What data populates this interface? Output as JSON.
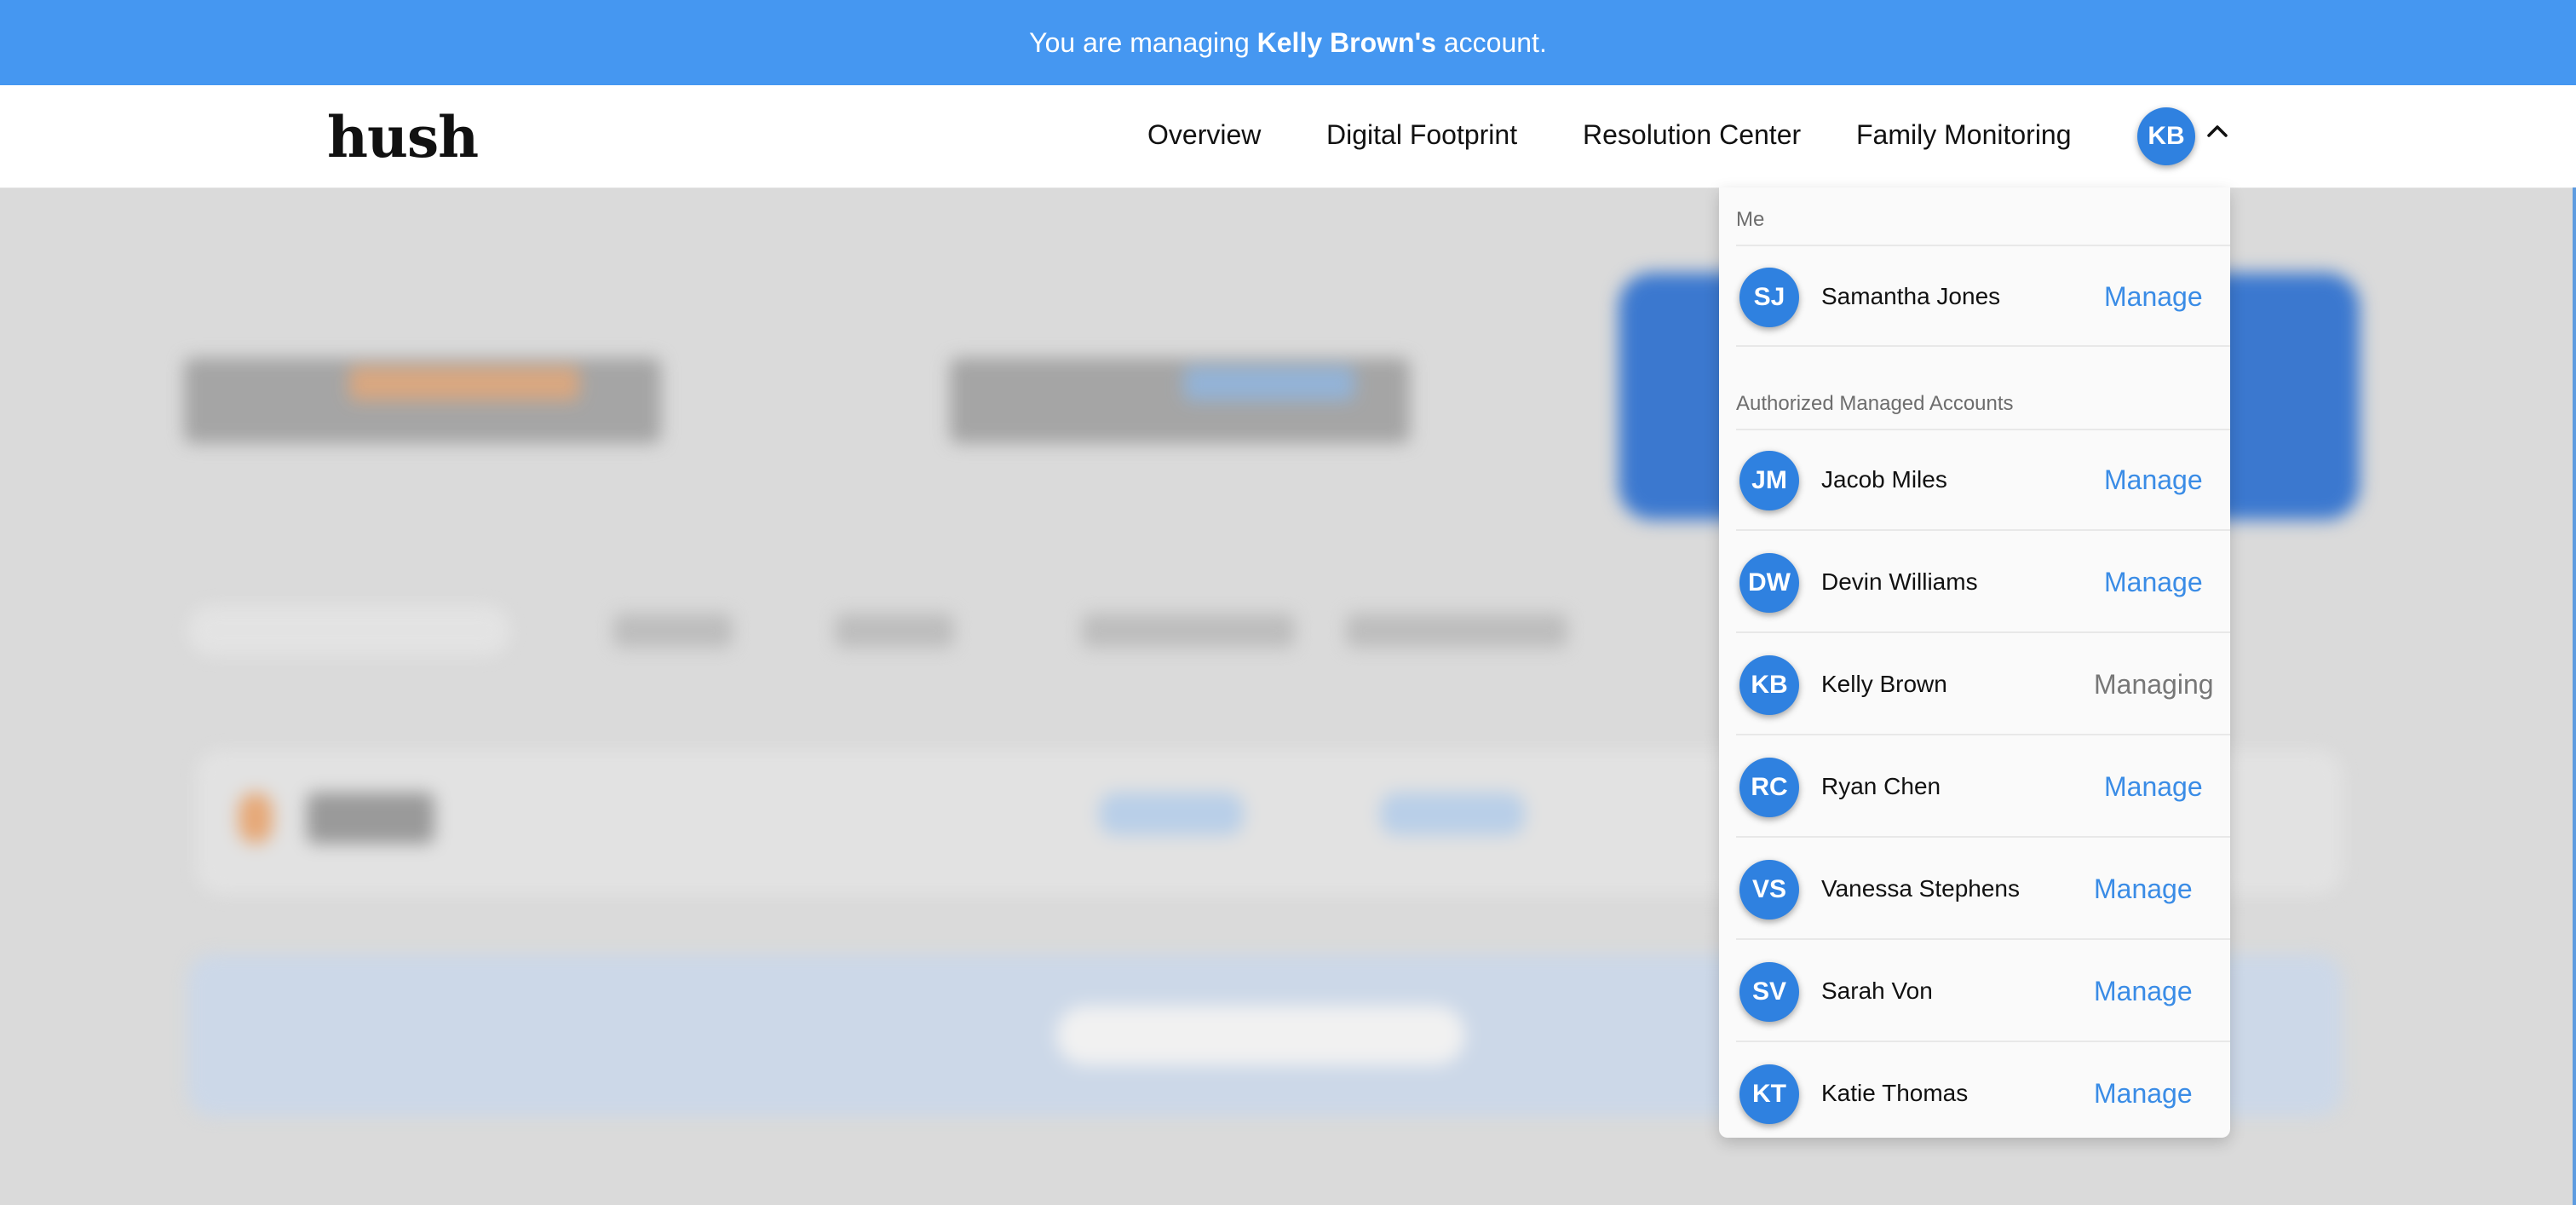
{
  "banner": {
    "prefix": "You are managing ",
    "account_name": "Kelly Brown's",
    "suffix": " account."
  },
  "navbar": {
    "logo": "hush",
    "links": [
      "Overview",
      "Digital Footprint",
      "Resolution Center",
      "Family Monitoring"
    ],
    "avatar_initials": "KB",
    "chevron_icon": "chevron-up-icon"
  },
  "dropdown": {
    "me_label": "Me",
    "me": {
      "initials": "SJ",
      "name": "Samantha Jones",
      "action": "Manage"
    },
    "managed_label": "Authorized Managed Accounts",
    "accounts": [
      {
        "initials": "JM",
        "name": "Jacob Miles",
        "action": "Manage"
      },
      {
        "initials": "DW",
        "name": "Devin Williams",
        "action": "Manage"
      },
      {
        "initials": "KB",
        "name": "Kelly Brown",
        "action": "Managing"
      },
      {
        "initials": "RC",
        "name": "Ryan Chen",
        "action": "Manage"
      },
      {
        "initials": "VS",
        "name": "Vanessa Stephens",
        "action": "Manage"
      },
      {
        "initials": "SV",
        "name": "Sarah Von",
        "action": "Manage"
      },
      {
        "initials": "KT",
        "name": "Katie Thomas",
        "action": "Manage"
      }
    ]
  },
  "colors": {
    "banner": "#4597f1",
    "avatar": "#2f81e0",
    "link": "#3a8ce6"
  }
}
